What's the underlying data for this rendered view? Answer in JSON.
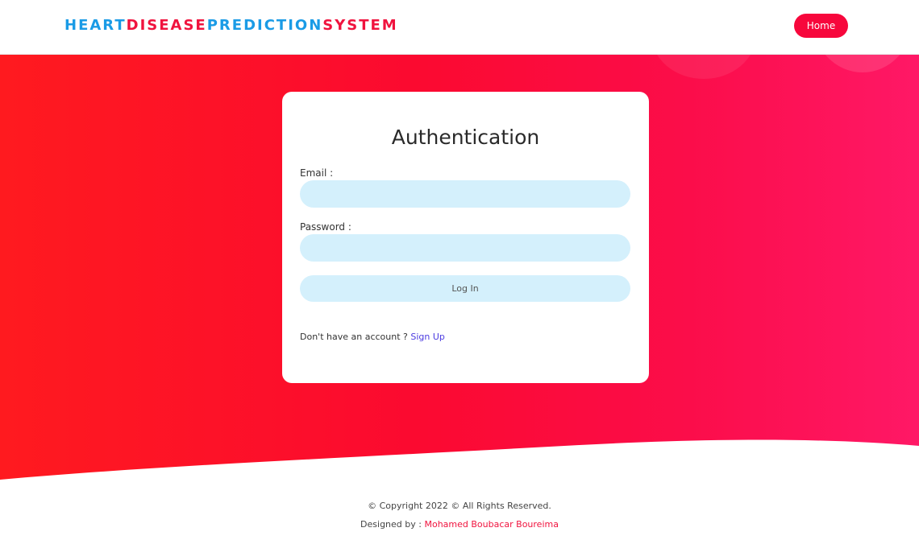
{
  "header": {
    "brand_parts": [
      "HEART",
      "DISEASE",
      "PREDICTION",
      "SYSTEM"
    ],
    "home_label": "Home"
  },
  "login": {
    "title": "Authentication",
    "email_label": "Email :",
    "email_value": "",
    "password_label": "Password :",
    "password_value": "",
    "submit_label": "Log In",
    "no_account_text": "Don't have an account ?",
    "signup_label": "Sign Up"
  },
  "footer": {
    "copyright": "© Copyright 2022 © All Rights Reserved.",
    "designed_by_label": "Designed by :",
    "designer_name": "Mohamed Boubacar Boureima"
  },
  "colors": {
    "brand_blue": "#1a9be6",
    "brand_red": "#f0133e",
    "accent": "#f7073c",
    "input_bg": "#d4f0fc",
    "link": "#4b3be0"
  }
}
